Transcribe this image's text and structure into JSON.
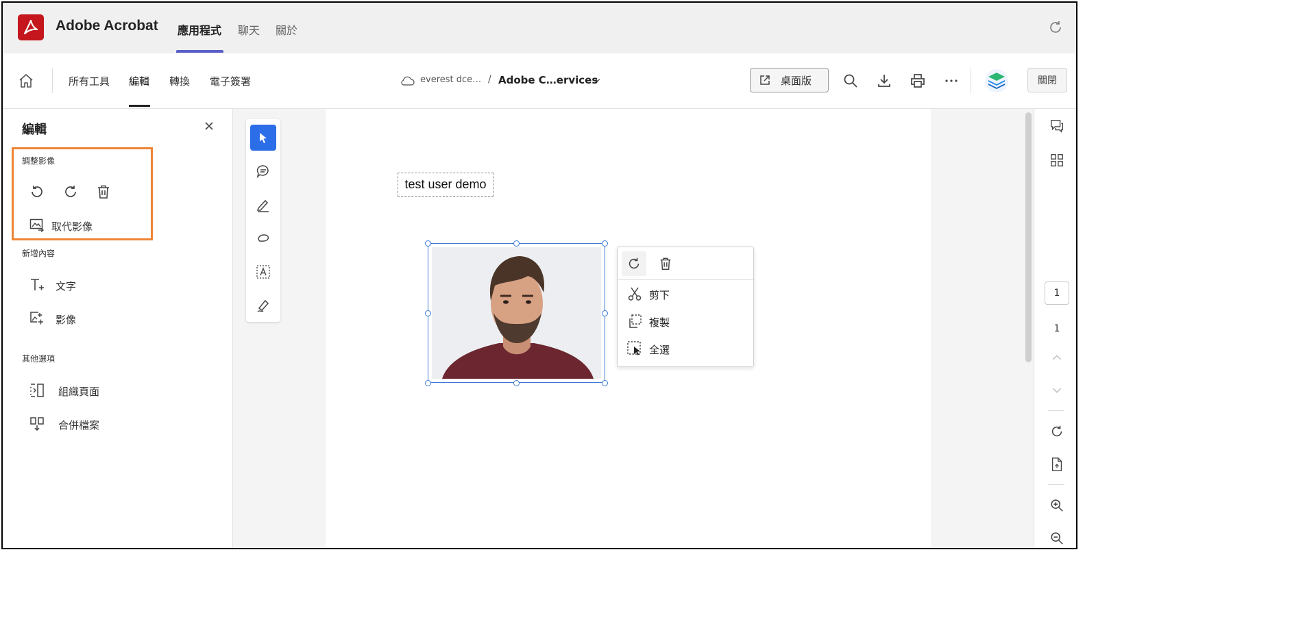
{
  "app": {
    "title": "Adobe Acrobat",
    "tabs": [
      {
        "label": "應用程式",
        "active": true
      },
      {
        "label": "聊天",
        "active": false
      },
      {
        "label": "關於",
        "active": false
      }
    ],
    "accent_color": "#5b5fc7",
    "brand_color": "#c4161c"
  },
  "toolbar": {
    "nav": [
      "所有工具",
      "編輯",
      "轉換",
      "電子簽署"
    ],
    "active_nav": "編輯",
    "breadcrumb_location": "everest dce…",
    "breadcrumb_separator": "/",
    "document_name": "Adobe C…ervices",
    "desktop_button": "桌面版",
    "close_button": "關閉"
  },
  "left_panel": {
    "title": "編輯",
    "sections": {
      "adjust_image": {
        "label": "調整影像",
        "replace_label": "取代影像"
      },
      "add_content": {
        "label": "新增內容",
        "items": [
          "文字",
          "影像"
        ]
      },
      "other_options": {
        "label": "其他選項",
        "items": [
          "組織頁面",
          "合併檔案"
        ]
      }
    },
    "highlight_color": "#ee8433"
  },
  "tools": [
    "select-tool",
    "comment-tool",
    "highlight-tool",
    "lasso-tool",
    "text-select-tool",
    "sign-tool"
  ],
  "document": {
    "text_box": "test user demo"
  },
  "context_menu": {
    "items": [
      "剪下",
      "複製",
      "全選"
    ]
  },
  "right_rail": {
    "current_page": "1",
    "total_pages": "1"
  }
}
